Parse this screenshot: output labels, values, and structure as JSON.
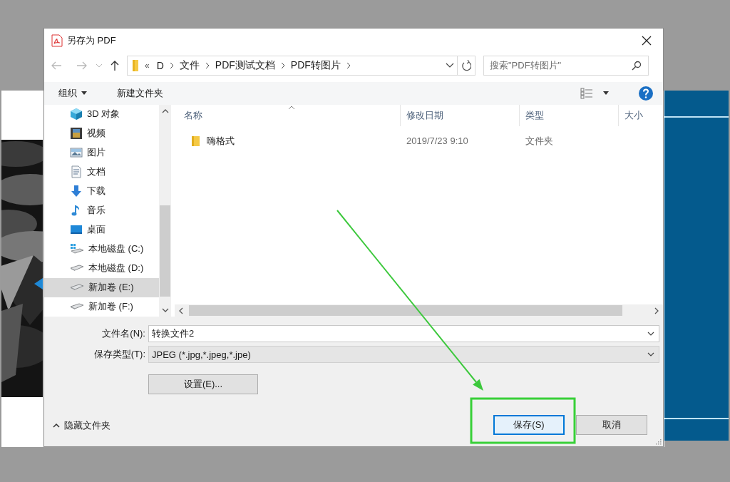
{
  "window": {
    "title": "另存为 PDF"
  },
  "address": {
    "crumbs": [
      "«",
      "D",
      "文件",
      "PDF测试文档",
      "PDF转图片"
    ]
  },
  "search": {
    "placeholder": "搜索\"PDF转图片\""
  },
  "toolbar": {
    "organize": "组织",
    "new_folder": "新建文件夹"
  },
  "nav": {
    "items": [
      {
        "label": "3D 对象",
        "kind": "objects3d",
        "selected": false
      },
      {
        "label": "视频",
        "kind": "video",
        "selected": false
      },
      {
        "label": "图片",
        "kind": "pictures",
        "selected": false
      },
      {
        "label": "文档",
        "kind": "documents",
        "selected": false
      },
      {
        "label": "下载",
        "kind": "downloads",
        "selected": false
      },
      {
        "label": "音乐",
        "kind": "music",
        "selected": false
      },
      {
        "label": "桌面",
        "kind": "desktop",
        "selected": false
      },
      {
        "label": "本地磁盘 (C:)",
        "kind": "system-drive",
        "selected": false
      },
      {
        "label": "本地磁盘 (D:)",
        "kind": "drive",
        "selected": false
      },
      {
        "label": "新加卷 (E:)",
        "kind": "drive",
        "selected": true
      },
      {
        "label": "新加卷 (F:)",
        "kind": "drive",
        "selected": false
      }
    ]
  },
  "table": {
    "columns": [
      {
        "label": "名称",
        "sorted": true
      },
      {
        "label": "修改日期",
        "sorted": false
      },
      {
        "label": "类型",
        "sorted": false
      },
      {
        "label": "大小",
        "sorted": false
      }
    ],
    "rows": [
      {
        "name": "嗨格式",
        "modified": "2019/7/23 9:10",
        "type": "文件夹"
      }
    ]
  },
  "form": {
    "file_name": {
      "label": "文件名(N):",
      "value": "转换文件2"
    },
    "file_type": {
      "label": "保存类型(T):",
      "value": "JPEG (*.jpg,*.jpeg,*.jpe)"
    }
  },
  "buttons": {
    "settings": "设置(E)...",
    "hide_folders": "隐藏文件夹",
    "save": {
      "label": "保存(S)",
      "default": true
    },
    "cancel": "取消"
  }
}
